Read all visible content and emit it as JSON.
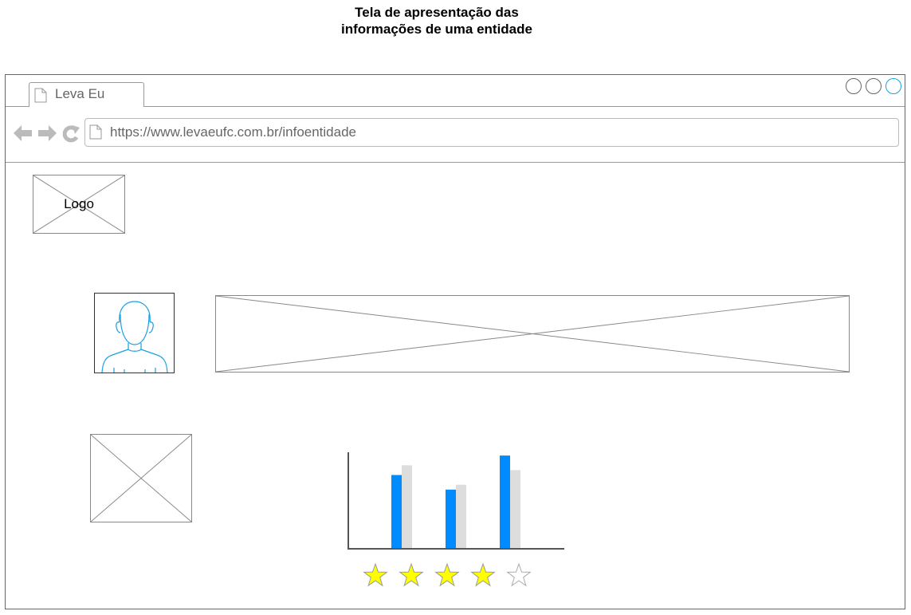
{
  "caption": {
    "line1": "Tela de apresentação das",
    "line2": "informações de uma entidade"
  },
  "browser": {
    "tab_title": "Leva Eu",
    "url": "https://www.levaeufc.com.br/infoentidade"
  },
  "logo": {
    "label": "Logo"
  },
  "chart_data": {
    "type": "bar",
    "categories": [
      "",
      "",
      ""
    ],
    "series": [
      {
        "values": [
          75,
          60,
          95
        ],
        "color": "#008cff"
      },
      {
        "values": [
          85,
          65,
          80
        ],
        "color": "#dddddd"
      }
    ],
    "ylim": [
      0,
      100
    ]
  },
  "rating": {
    "value": 4,
    "max": 5,
    "filled_color": "#ffff00",
    "empty_color": "#ffffff"
  },
  "icons": [
    "document-icon",
    "back-arrow-icon",
    "forward-arrow-icon",
    "reload-icon",
    "user-avatar-icon",
    "star-icon",
    "window-control-icon"
  ]
}
